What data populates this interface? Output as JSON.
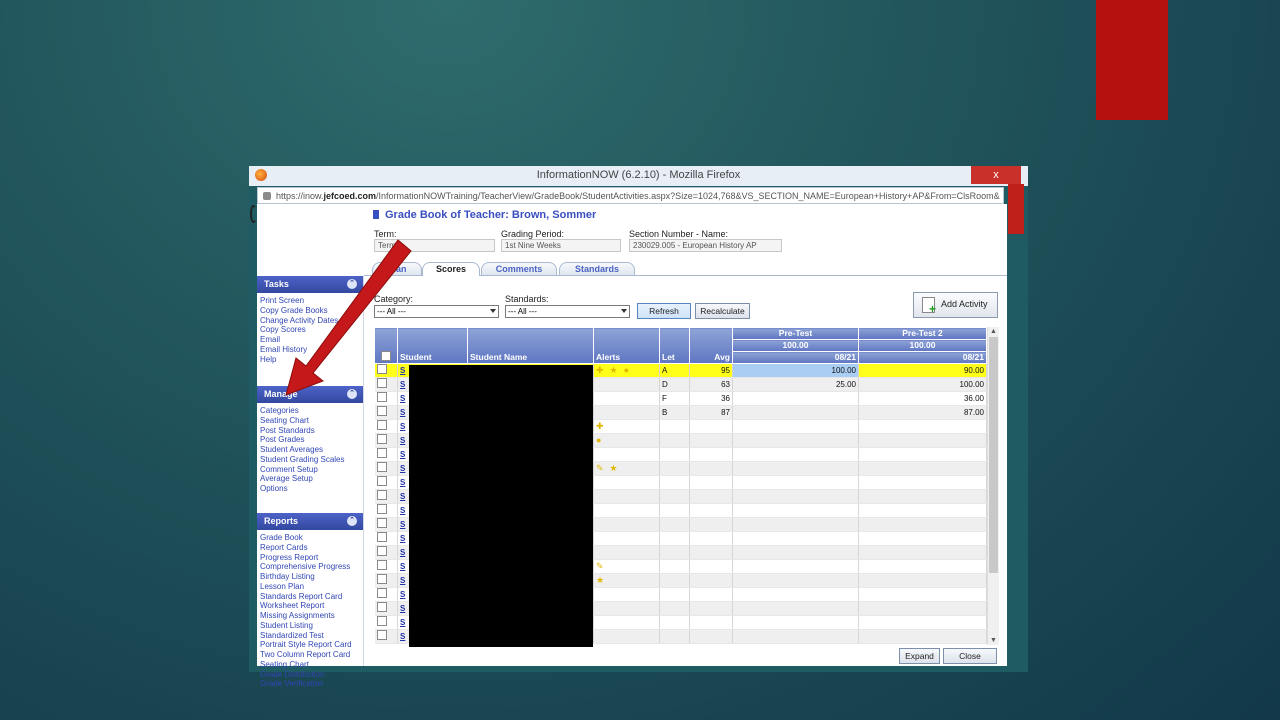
{
  "window": {
    "title": "InformationNOW (6.2.10) - Mozilla Firefox",
    "close_glyph": "x",
    "url_prefix": "https://inow.",
    "url_domain": "jefcoed.com",
    "url_path": "/InformationNOWTraining/TeacherView/GradeBook/StudentActivities.aspx?Size=1024,768&VS_SECTION_NAME=European+History+AP&From=ClsRoom&"
  },
  "sidebar": {
    "tasks": {
      "title": "Tasks",
      "items": [
        "Print Screen",
        "Copy Grade Books",
        "Change Activity Dates",
        "Copy Scores",
        "Email",
        "Email History",
        "Help"
      ]
    },
    "manage": {
      "title": "Manage",
      "items": [
        "Categories",
        "Seating Chart",
        "Post Standards",
        "Post Grades",
        "Student Averages",
        "Student Grading Scales",
        "Comment Setup",
        "Average Setup",
        "Options"
      ]
    },
    "reports": {
      "title": "Reports",
      "items": [
        "Grade Book",
        "Report Cards",
        "Progress Report",
        "Comprehensive Progress",
        "Birthday Listing",
        "Lesson Plan",
        "Standards Report Card",
        "Worksheet Report",
        "Missing Assignments",
        "Student Listing",
        "Standardized Test",
        "Portrait Style Report Card",
        "Two Column Report Card",
        "Seating Chart",
        "Grade Distribution",
        "Grade Verification"
      ]
    },
    "chevron_glyph": "⌃"
  },
  "gradebook": {
    "title": "Grade Book of Teacher: Brown, Sommer",
    "term_label": "Term:",
    "term_value": "Term 1",
    "grading_period_label": "Grading Period:",
    "grading_period_value": "1st Nine Weeks",
    "section_label": "Section Number - Name:",
    "section_value": "230029.005 - European History AP",
    "tabs": [
      "Plan",
      "Scores",
      "Comments",
      "Standards"
    ],
    "active_tab": "Scores",
    "category_label": "Category:",
    "category_value": "--- All ---",
    "standards_label": "Standards:",
    "standards_value": "--- All ---",
    "refresh_label": "Refresh",
    "recalculate_label": "Recalculate",
    "add_activity_label": "Add Activity",
    "expand_label": "Expand",
    "close_label": "Close"
  },
  "table": {
    "headers": {
      "student": "Student",
      "student_name": "Student Name",
      "alerts": "Alerts",
      "let": "Let",
      "avg": "Avg"
    },
    "activities": [
      {
        "name": "Pre-Test",
        "points": "100.00",
        "date": "08/21"
      },
      {
        "name": "Pre-Test 2",
        "points": "100.00",
        "date": "08/21"
      }
    ],
    "rows": [
      {
        "id": "S",
        "let": "A",
        "avg": "95",
        "s1": "100.00",
        "s2": "90.00"
      },
      {
        "id": "S",
        "let": "D",
        "avg": "63",
        "s1": "25.00",
        "s2": "100.00"
      },
      {
        "id": "S",
        "let": "F",
        "avg": "36",
        "s1": "",
        "s2": "36.00"
      },
      {
        "id": "S",
        "let": "B",
        "avg": "87",
        "s1": "",
        "s2": "87.00"
      },
      {
        "id": "S",
        "let": "",
        "avg": "",
        "s1": "",
        "s2": ""
      },
      {
        "id": "S",
        "let": "",
        "avg": "",
        "s1": "",
        "s2": ""
      },
      {
        "id": "S",
        "let": "",
        "avg": "",
        "s1": "",
        "s2": ""
      },
      {
        "id": "S",
        "let": "",
        "avg": "",
        "s1": "",
        "s2": ""
      },
      {
        "id": "S",
        "let": "",
        "avg": "",
        "s1": "",
        "s2": ""
      },
      {
        "id": "S",
        "let": "",
        "avg": "",
        "s1": "",
        "s2": ""
      },
      {
        "id": "S",
        "let": "",
        "avg": "",
        "s1": "",
        "s2": ""
      },
      {
        "id": "S",
        "let": "",
        "avg": "",
        "s1": "",
        "s2": ""
      },
      {
        "id": "S",
        "let": "",
        "avg": "",
        "s1": "",
        "s2": ""
      },
      {
        "id": "S",
        "let": "",
        "avg": "",
        "s1": "",
        "s2": ""
      },
      {
        "id": "S",
        "let": "",
        "avg": "",
        "s1": "",
        "s2": ""
      },
      {
        "id": "S",
        "let": "",
        "avg": "",
        "s1": "",
        "s2": ""
      },
      {
        "id": "S",
        "let": "",
        "avg": "",
        "s1": "",
        "s2": ""
      },
      {
        "id": "S",
        "let": "",
        "avg": "",
        "s1": "",
        "s2": ""
      },
      {
        "id": "S",
        "let": "",
        "avg": "",
        "s1": "",
        "s2": ""
      },
      {
        "id": "S",
        "let": "",
        "avg": "",
        "s1": "",
        "s2": ""
      }
    ],
    "alert_icons": [
      [
        "plus-icon",
        "star-icon",
        "bulb-icon"
      ],
      [],
      [],
      [],
      [
        "plus-icon"
      ],
      [
        "bulb-icon"
      ],
      [],
      [
        "pencil-icon",
        "star-icon"
      ],
      [],
      [],
      [],
      [],
      [],
      [],
      [
        "pencil-icon"
      ],
      [
        "star-icon"
      ],
      [],
      [],
      [],
      []
    ]
  },
  "colors": {
    "accent_red": "#b5120f",
    "highlight_yellow": "#ffff1a",
    "header_blue": "#5e76c2"
  }
}
